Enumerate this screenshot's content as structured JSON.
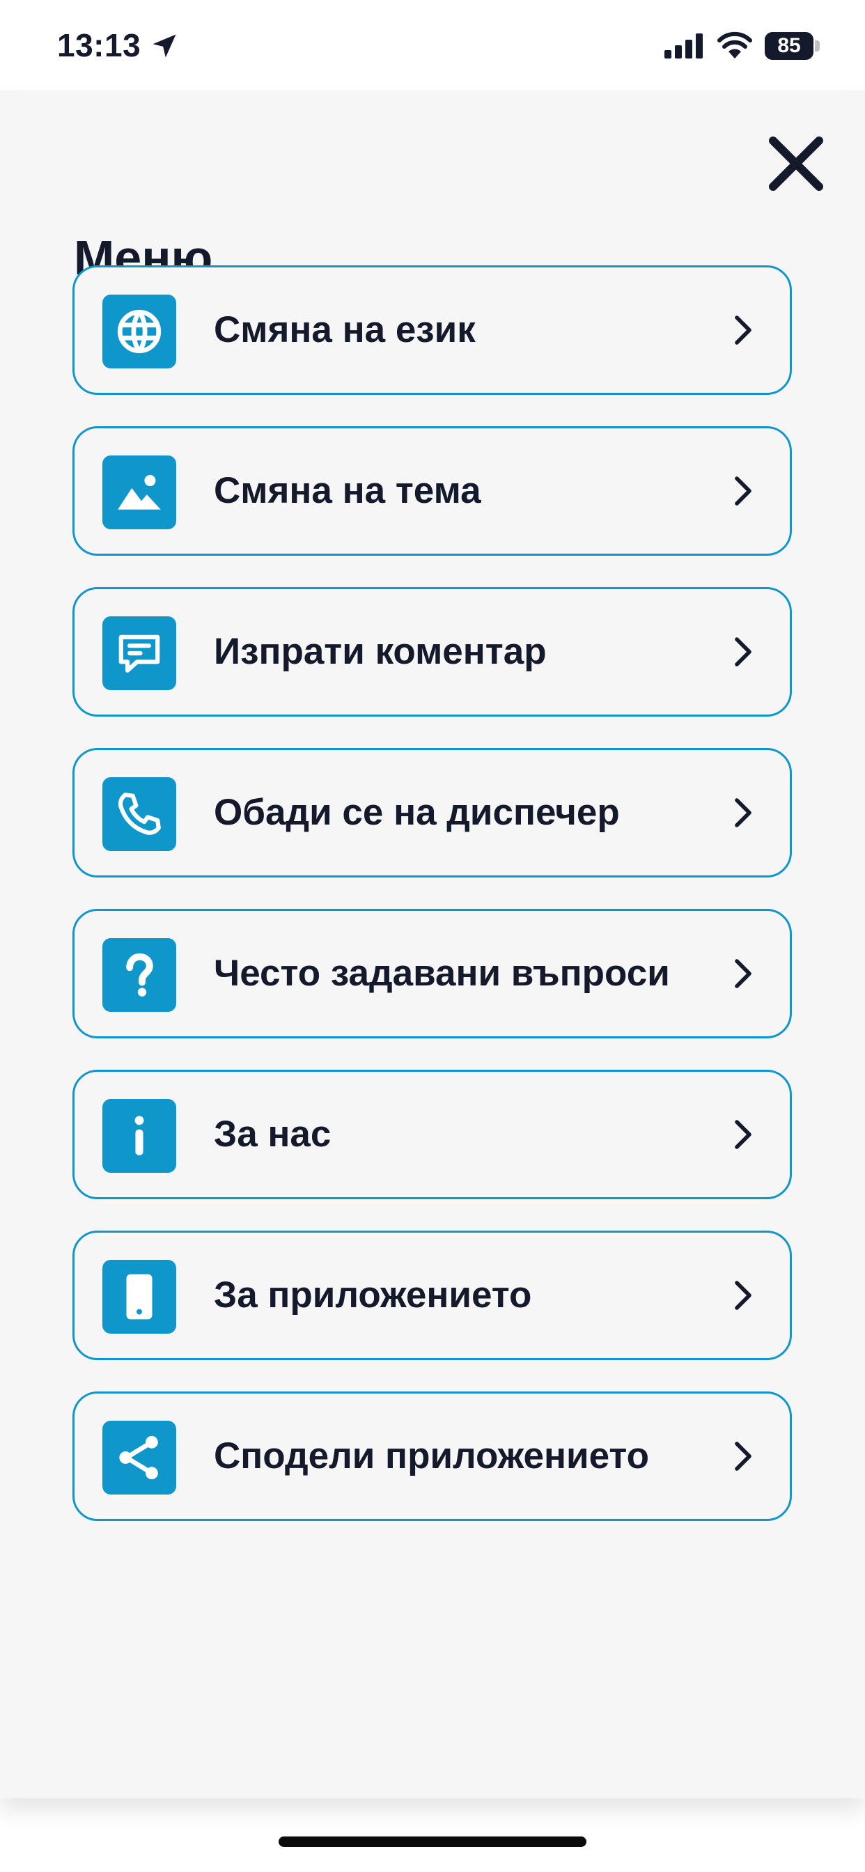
{
  "status_bar": {
    "time": "13:13",
    "battery_level": "85",
    "icons": [
      "location-arrow-icon",
      "cellular-signal-icon",
      "wifi-icon",
      "battery-icon"
    ]
  },
  "menu": {
    "title": "Меню",
    "close_icon": "close-icon",
    "items": [
      {
        "label": "Смяна на език",
        "icon": "globe-icon"
      },
      {
        "label": "Смяна на тема",
        "icon": "image-icon"
      },
      {
        "label": "Изпрати коментар",
        "icon": "chat-bubble-icon"
      },
      {
        "label": "Обади се на диспечер",
        "icon": "phone-icon"
      },
      {
        "label": "Често задавани въпроси",
        "icon": "question-mark-icon"
      },
      {
        "label": "За нас",
        "icon": "info-icon"
      },
      {
        "label": "За приложението",
        "icon": "mobile-phone-icon"
      },
      {
        "label": "Сподели приложението",
        "icon": "share-icon"
      }
    ]
  },
  "colors": {
    "accent": "#0f97cc",
    "text": "#14192b",
    "background": "#f6f6f7"
  }
}
